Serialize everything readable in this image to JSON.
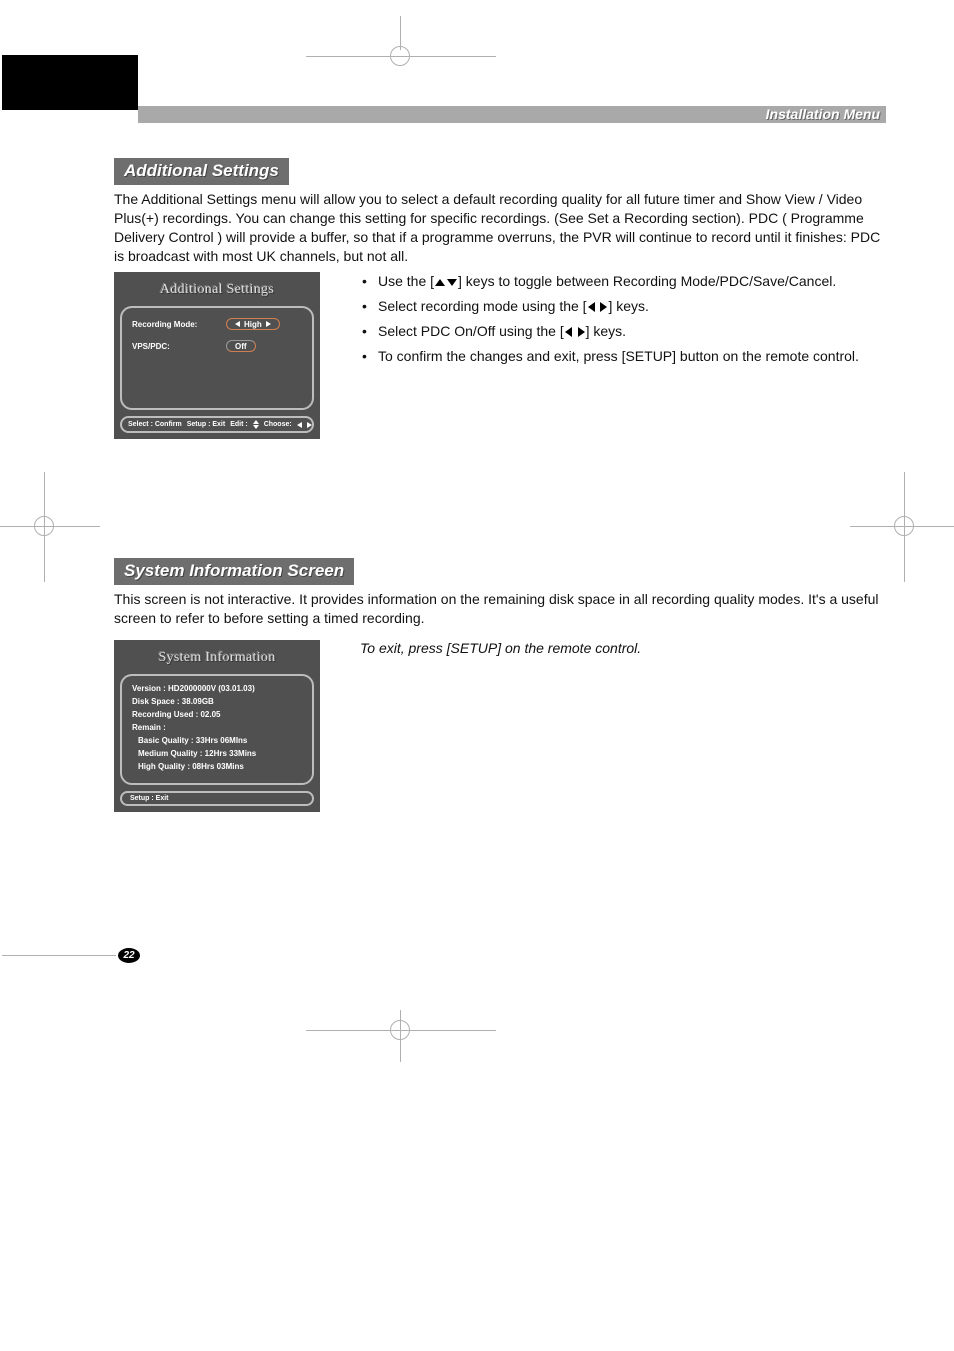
{
  "header": {
    "title": "Installation Menu"
  },
  "section1": {
    "bar": "Additional Settings",
    "intro": "The Additional Settings menu will allow you to select a default recording quality for all future timer and Show View / Video Plus(+) recordings.  You can change this setting for specific recordings. (See Set a Recording section). PDC ( Programme Delivery Control ) will provide a buffer, so that if a programme overruns, the PVR will continue to record until it finishes: PDC is broadcast with most UK channels, but not all.",
    "osd": {
      "title": "Additional Settings",
      "rec_mode_label": "Recording Mode:",
      "rec_mode_value": "High",
      "vps_label": "VPS/PDC:",
      "vps_value": "Off",
      "footer_select": "Select : Confirm",
      "footer_setup": "Setup : Exit",
      "footer_edit": "Edit :",
      "footer_choose": "Choose:"
    },
    "instructions": {
      "i1a": "Use the [",
      "i1b": "] keys to toggle between Recording Mode/PDC/Save/Cancel.",
      "i2a": "Select recording mode using the [",
      "i2b": "] keys.",
      "i3a": "Select PDC On/Off using the [",
      "i3b": "] keys.",
      "i4": "To confirm the changes and exit, press [SETUP] button on the remote control."
    }
  },
  "section2": {
    "bar": "System Information Screen",
    "intro": "This screen is not interactive. It provides information on the remaining disk space in all recording quality modes. It's a useful screen to refer to before setting a timed recording.",
    "osd": {
      "title": "System Information",
      "version": "Version : HD2000000V (03.01.03)",
      "disk": "Disk Space : 38.09GB",
      "rec_used": "Recording Used : 02.05",
      "remain": "Remain :",
      "basic": "Basic Quality : 33Hrs 06MIns",
      "medium": "Medium Quality : 12Hrs 33Mins",
      "high": "High Quality : 08Hrs 03Mins",
      "footer": "Setup : Exit"
    },
    "exit_note": "To exit, press [SETUP] on the remote control."
  },
  "page_number": "22"
}
